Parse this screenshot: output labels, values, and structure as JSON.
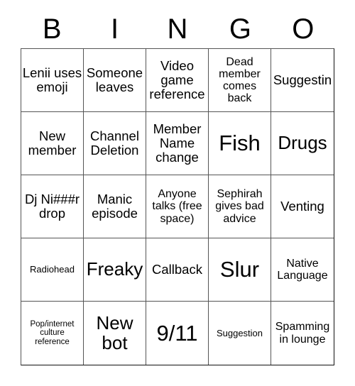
{
  "card": {
    "header_letters": [
      "B",
      "I",
      "N",
      "G",
      "O"
    ],
    "columns": 5,
    "rows": 5,
    "colors": {
      "background": "#ffffff",
      "text": "#000000",
      "grid_line": "#555555",
      "outer_border": "#111111"
    },
    "cells": [
      {
        "text": "Lenii uses emoji",
        "size": "md"
      },
      {
        "text": "Someone leaves",
        "size": "md"
      },
      {
        "text": "Video game reference",
        "size": "md"
      },
      {
        "text": "Dead member comes back",
        "size": "sm"
      },
      {
        "text": "Suggestin",
        "size": "md"
      },
      {
        "text": "New member",
        "size": "md"
      },
      {
        "text": "Channel Deletion",
        "size": "md"
      },
      {
        "text": "Member Name change",
        "size": "md"
      },
      {
        "text": "Fish",
        "size": "xl"
      },
      {
        "text": "Drugs",
        "size": "lg"
      },
      {
        "text": "Dj Ni###r drop",
        "size": "md"
      },
      {
        "text": "Manic episode",
        "size": "md"
      },
      {
        "text": "Anyone talks (free space)",
        "size": "sm"
      },
      {
        "text": "Sephirah gives bad advice",
        "size": "sm"
      },
      {
        "text": "Venting",
        "size": "md"
      },
      {
        "text": "Radiohead",
        "size": "xs"
      },
      {
        "text": "Freaky",
        "size": "lg"
      },
      {
        "text": "Callback",
        "size": "md"
      },
      {
        "text": "Slur",
        "size": "xl"
      },
      {
        "text": "Native Language",
        "size": "sm"
      },
      {
        "text": "Pop/internet culture reference",
        "size": "xxs"
      },
      {
        "text": "New bot",
        "size": "lg"
      },
      {
        "text": "9/11",
        "size": "xl"
      },
      {
        "text": "Suggestion",
        "size": "xs"
      },
      {
        "text": "Spamming in lounge",
        "size": "sm"
      }
    ]
  }
}
